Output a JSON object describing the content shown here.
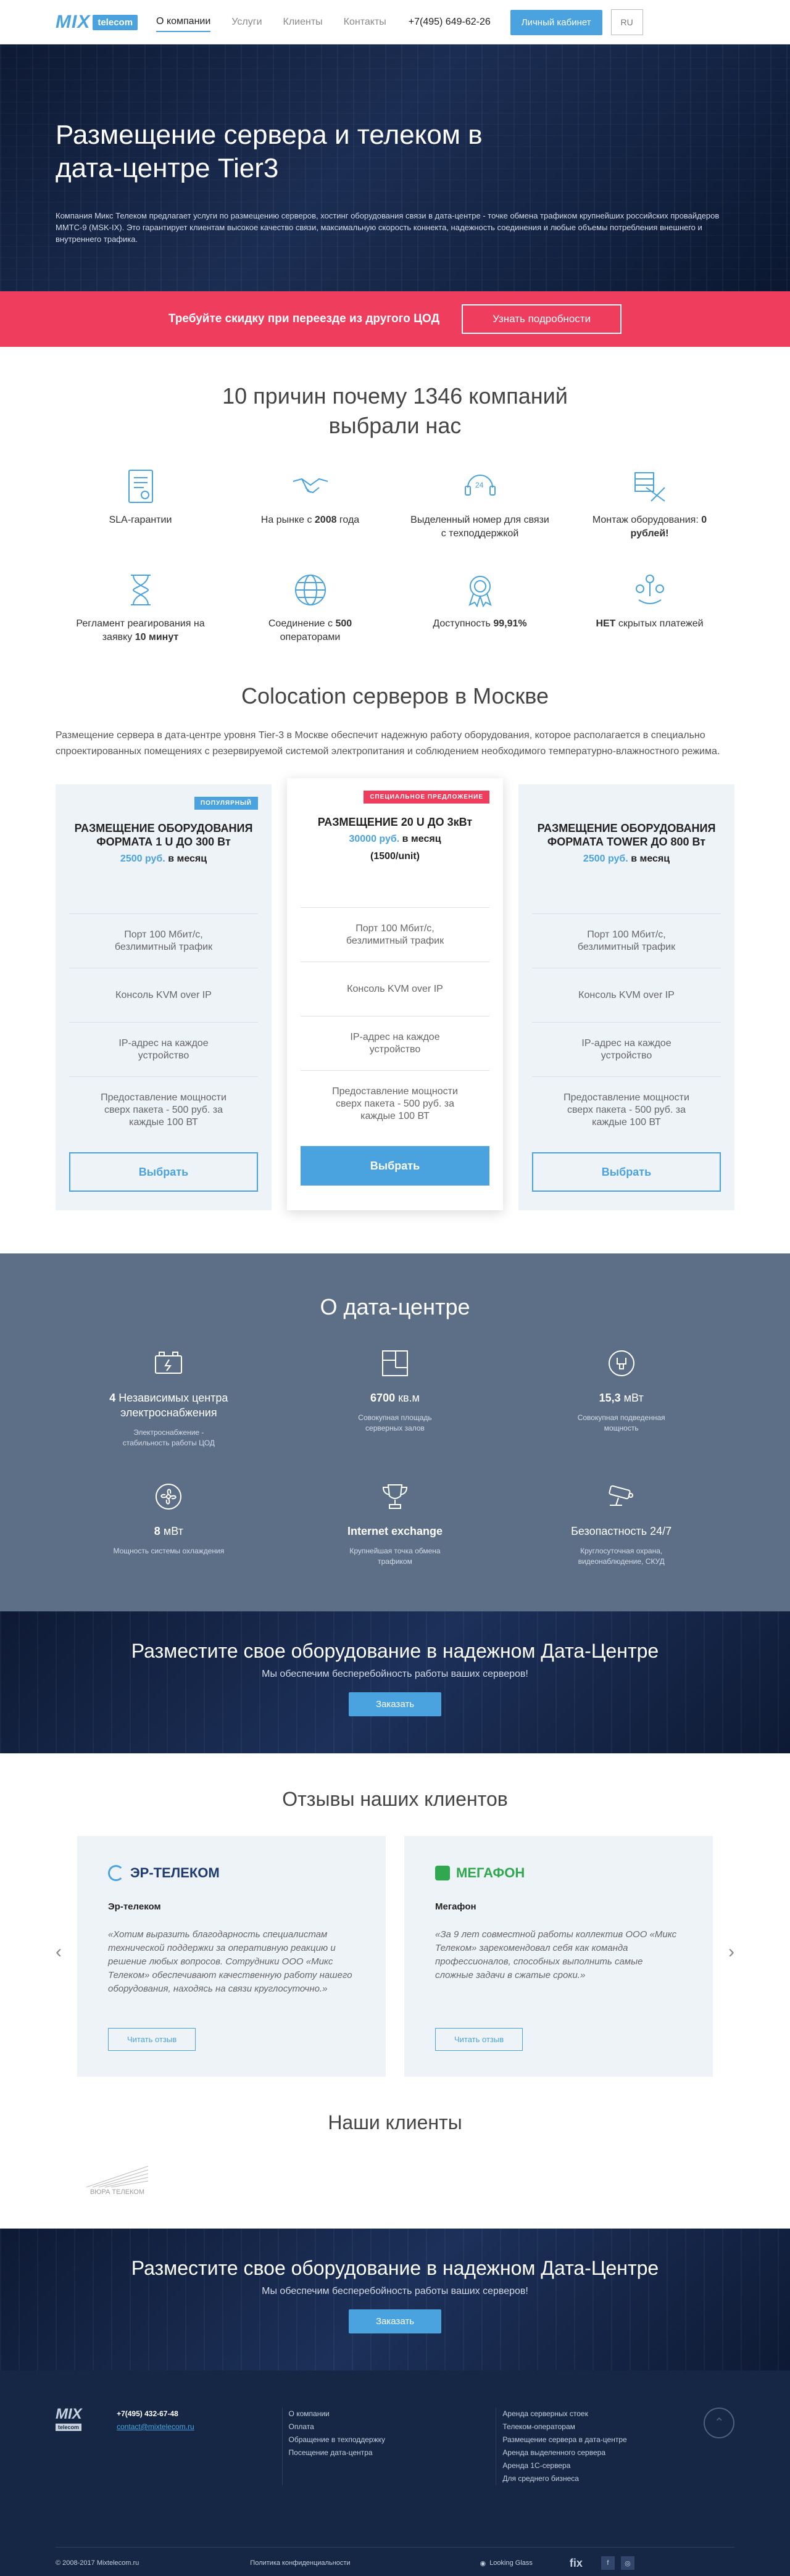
{
  "header": {
    "logo_mix": "MIX",
    "logo_tel": "telecom",
    "nav": [
      "О компании",
      "Услуги",
      "Клиенты",
      "Контакты"
    ],
    "phone": "+7(495) 649-62-26",
    "cabinet": "Личный кабинет",
    "lang": "RU"
  },
  "hero": {
    "title": "Размещение сервера и телеком в дата-центре Tier3",
    "text": "Компания Микс Телеком предлагает услуги по размещению серверов, хостинг оборудования связи в дата-центре - точке обмена трафиком крупнейших российских провайдеров ММТС-9 (MSK-IX). Это гарантирует клиентам высокое качество связи, максимальную скорость коннекта, надежность соединения и любые объемы потребления внешнего и внутреннего трафика."
  },
  "promo": {
    "text": "Требуйте скидку при переезде из другого ЦОД",
    "button": "Узнать подробности"
  },
  "reasons": {
    "title": "10 причин почему 1346 компаний выбрали нас",
    "items": [
      {
        "icon": "document-icon",
        "pre": "SLA-гарантии",
        "bold": "",
        "post": ""
      },
      {
        "icon": "handshake-icon",
        "pre": "На рынке с ",
        "bold": "2008",
        "post": " года"
      },
      {
        "icon": "support-24-icon",
        "pre": "Выделенный номер для связи с техподдержкой",
        "bold": "",
        "post": ""
      },
      {
        "icon": "tools-icon",
        "pre": "Монтаж оборудования: ",
        "bold": "0 рублей!",
        "post": ""
      },
      {
        "icon": "hourglass-icon",
        "pre": "Регламент реагирования на заявку ",
        "bold": "10 минут",
        "post": ""
      },
      {
        "icon": "globe-icon",
        "pre": "Соединение с ",
        "bold": "500",
        "post": " операторами"
      },
      {
        "icon": "award-icon",
        "pre": "Доступность ",
        "bold": "99,91%",
        "post": ""
      },
      {
        "icon": "coins-icon",
        "pre": "",
        "bold": "НЕТ",
        "post": " скрытых платежей"
      }
    ]
  },
  "coloc": {
    "title": "Colocation серверов в Москве",
    "desc": "Размещение сервера в дата-центре уровня Tier-3 в Москве обеспечит надежную работу оборудования, которое располагается в специально спроектированных помещениях с резервируемой системой электропитания и соблюдением необходимого температурно-влажностного режима.",
    "plans": [
      {
        "badge": "ПОПУЛЯРНЫЙ",
        "name": "РАЗМЕЩЕНИЕ ОБОРУДОВАНИЯ ФОРМАТА 1 U ДО 300 Вт",
        "price": "2500 руб.",
        "period": " в месяц",
        "extra": "",
        "features": [
          "Порт 100 Мбит/с, безлимитный трафик",
          "Консоль KVM over IP",
          "IP-адрес на каждое устройство",
          "Предоставление мощности сверх пакета - 500 руб. за каждые 100 ВТ"
        ],
        "button": "Выбрать"
      },
      {
        "badge": "СПЕЦИАЛЬНОЕ ПРЕДЛОЖЕНИЕ",
        "name": "РАЗМЕЩЕНИЕ 20 U ДО 3кВт",
        "price": "30000 руб.",
        "period": " в месяц",
        "extra": "(1500/unit)",
        "features": [
          "Порт 100 Мбит/с, безлимитный трафик",
          "Консоль KVM over IP",
          "IP-адрес на каждое устройство",
          "Предоставление мощности сверх пакета - 500 руб. за каждые 100 ВТ"
        ],
        "button": "Выбрать"
      },
      {
        "badge": "",
        "name": "РАЗМЕЩЕНИЕ ОБОРУДОВАНИЯ ФОРМАТА TOWER ДО 800 Вт",
        "price": "2500 руб.",
        "period": " в месяц",
        "extra": "",
        "features": [
          "Порт 100 Мбит/с, безлимитный трафик",
          "Консоль KVM over IP",
          "IP-адрес на каждое устройство",
          "Предоставление мощности сверх пакета - 500 руб. за каждые 100 ВТ"
        ],
        "button": "Выбрать"
      }
    ]
  },
  "about": {
    "title": "О дата-центре",
    "items": [
      {
        "icon": "battery-icon",
        "bold": "4",
        "val": " Независимых центра электроснабжения",
        "note": "Электроснабжение - стабильность работы ЦОД"
      },
      {
        "icon": "floorplan-icon",
        "bold": "6700",
        "val": " кв.м",
        "note": "Совокупная площадь серверных залов"
      },
      {
        "icon": "power-icon",
        "bold": "15,3",
        "val": " мВт",
        "note": "Совокупная подведенная мощность"
      },
      {
        "icon": "cooling-icon",
        "bold": "8",
        "val": " мВт",
        "note": "Мощность системы охлаждения"
      },
      {
        "icon": "trophy-icon",
        "bold": "Internet exchange",
        "val": "",
        "note": "Крупнейшая точка обмена трафиком"
      },
      {
        "icon": "camera-icon",
        "bold": "",
        "val": "Безопастность 24/7",
        "note": "Круглосуточная охрана, видеонаблюдение, СКУД"
      }
    ]
  },
  "cta": {
    "title": "Разместите свое оборудование в надежном Дата-Центре",
    "sub": "Мы обеспечим бесперебойность работы ваших серверов!",
    "button": "Заказать"
  },
  "reviews": {
    "title": "Отзывы наших клиентов",
    "items": [
      {
        "logo": "ЭР-ТЕЛЕКОМ",
        "name": "Эр-телеком",
        "text": "«Хотим выразить благодарность специалистам технической поддержки за оперативную реакцию и решение любых вопросов. Сотрудники ООО «Микс Телеком» обеспечивают качественную работу нашего оборудования, находясь на связи круглосуточно.»",
        "button": "Читать отзыв"
      },
      {
        "logo": "МЕГАФОН",
        "name": "Мегафон",
        "text": "«За 9 лет совместной работы коллектив ООО «Микс Телеком» зарекомендовал себя как команда профессионалов, способных выполнить самые сложные задачи в сжатые сроки.»",
        "button": "Читать отзыв"
      }
    ]
  },
  "clients": {
    "title": "Наши клиенты",
    "logo": "ВЮРА ТЕЛЕКОМ"
  },
  "cta2": {
    "title": "Разместите свое оборудование в надежном Дата-Центре",
    "sub": "Мы обеспечим бесперебойность работы ваших серверов!",
    "button": "Заказать"
  },
  "footer": {
    "phone": "+7(495) 432-67-48",
    "email": "contact@mixtelecom.ru",
    "menu1": [
      "О компании",
      "Оплата",
      "Обращение в техподдержку",
      "Посещение дата-центра"
    ],
    "menu2": [
      "Аренда серверных стоек",
      "Телеком-операторам",
      "Размещение сервера в дата-центре",
      "Аренда выделенного сервера",
      "Аренда 1С-сервера",
      "Для среднего бизнеса"
    ],
    "copyright": "© 2008-2017 Mixtelecom.ru",
    "policy": "Политика конфиденциальности",
    "lg": "Looking Glass",
    "fix": "fix"
  }
}
